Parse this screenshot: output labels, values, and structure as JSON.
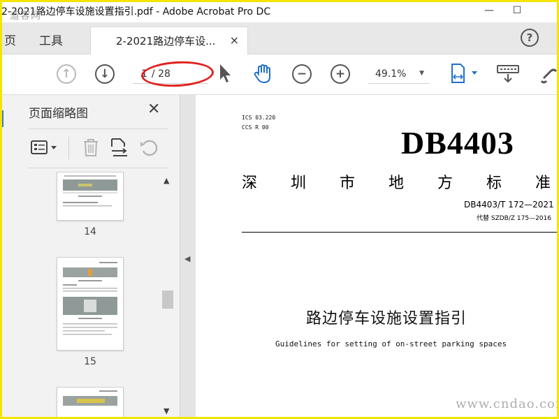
{
  "window": {
    "title": "2-2021路边停车设施设置指引.pdf - Adobe Acrobat Pro DC",
    "watermark": "道客网",
    "minimize_glyph": "—",
    "maximize_glyph": "☐"
  },
  "tabs": {
    "items": [
      {
        "label": "页"
      },
      {
        "label": "工具"
      }
    ],
    "document_tab": {
      "label": "2-2021路边停车设...",
      "close": "×"
    },
    "help": "?"
  },
  "toolbar": {
    "prev_page": "↑",
    "next_page": "↓",
    "current_page": "1",
    "total_pages": "/ 28",
    "zoom_out": "−",
    "zoom_in": "+",
    "zoom_value": "49.1%",
    "zoom_arrow": "▼",
    "icons": [
      "select-arrow-icon",
      "hand-tool-icon",
      "fit-page-icon",
      "keyboard-icon",
      "link-icon"
    ]
  },
  "thumbnail_pane": {
    "title": "页面缩略图",
    "close": "✕",
    "tools": [
      "thumbnail-options-icon",
      "delete-icon",
      "insert-page-icon",
      "undo-rotate-icon"
    ],
    "pages": [
      {
        "label": "14"
      },
      {
        "label": "15"
      }
    ],
    "scroll_up": "▲",
    "scroll_down": "▼",
    "collapse_arrow": "◀"
  },
  "document": {
    "ics": "ICS 03.220",
    "ccs": "CCS R 00",
    "db_code": "DB4403",
    "standard_type_chars": [
      "深",
      "圳",
      "市",
      "地",
      "方",
      "标",
      "准"
    ],
    "standard_number": "DB4403/T 172—2021",
    "supersedes": "代替 SZDB/Z 175—2016",
    "title_cn": "路边停车设施设置指引",
    "title_en": "Guidelines for setting of on-street parking spaces"
  },
  "footer_watermark": "www.cndao.com",
  "colors": {
    "accent_blue": "#3a7bd5",
    "annotation_red": "#e02020",
    "frame_yellow": "#f5e400"
  }
}
